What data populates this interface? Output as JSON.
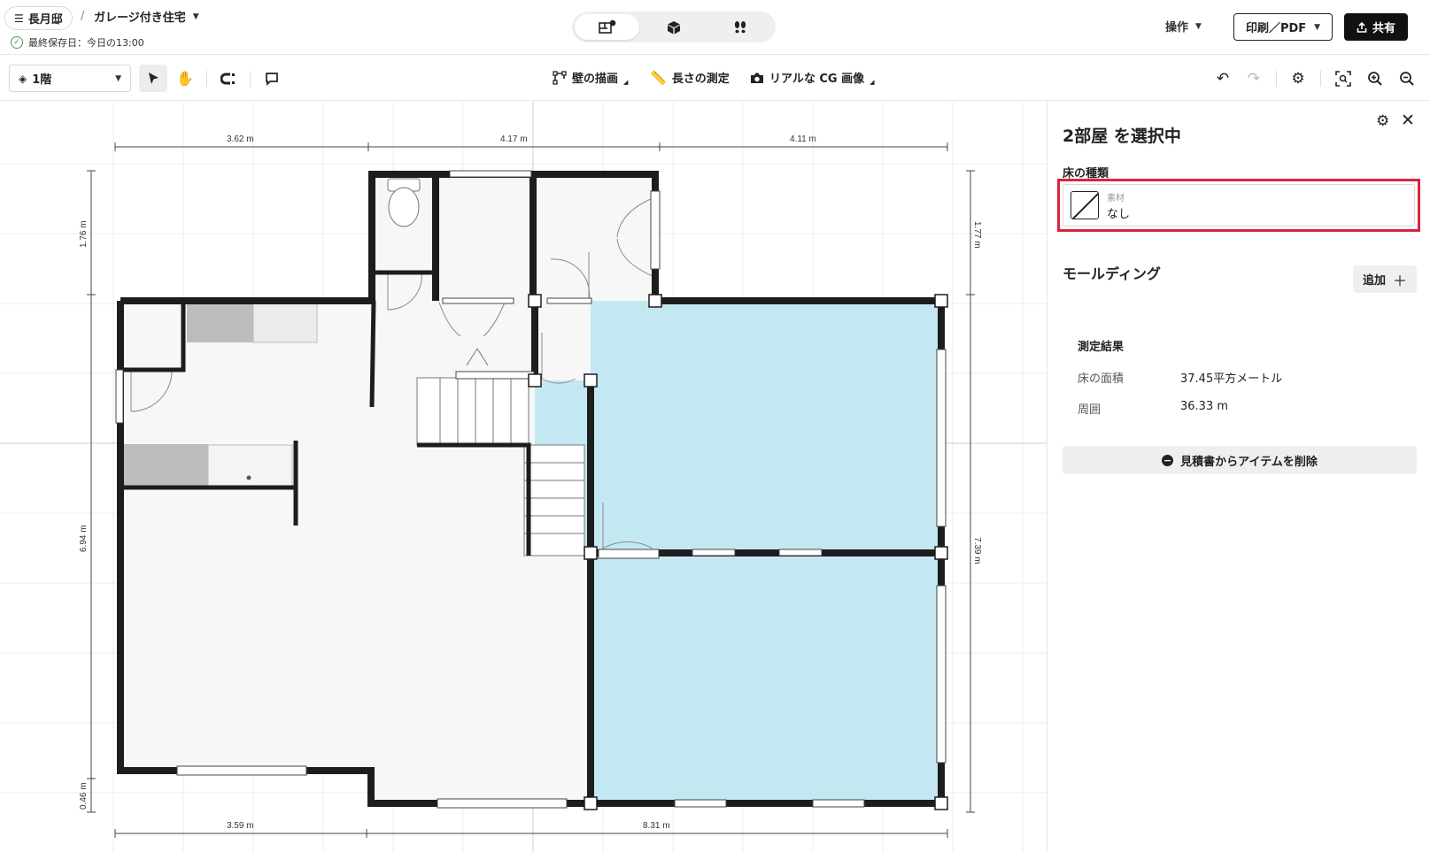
{
  "header": {
    "menu_label": "長月邸",
    "breadcrumb_sep": "/",
    "project_title": "ガレージ付き住宅",
    "save_status": "最終保存日：今日の13:00",
    "ops_label": "操作",
    "print_label": "印刷／PDF",
    "share_label": "共有"
  },
  "toolbar": {
    "floor_label": "1階",
    "draw_walls": "壁の描画",
    "measure": "長さの測定",
    "render": "リアルな CG 画像"
  },
  "canvas": {
    "dims_top": [
      "3.62 m",
      "4.17 m",
      "4.11 m"
    ],
    "dims_bottom": [
      "3.59 m",
      "8.31 m"
    ],
    "dims_left": [
      "1.76 m",
      "6.94 m",
      "0.46 m"
    ],
    "dims_right": [
      "1.77 m",
      "7.39 m"
    ],
    "selection_color": "#c4e8f2"
  },
  "panel": {
    "title": "2部屋 を選択中",
    "floor_type_label": "床の種類",
    "material_caption": "素材",
    "material_value": "なし",
    "molding_label": "モールディング",
    "add_label": "追加",
    "results_title": "測定結果",
    "results": [
      {
        "key": "床の面積",
        "value": "37.45平方メートル"
      },
      {
        "key": "周囲",
        "value": "36.33 m"
      }
    ],
    "delete_label": "見積書からアイテムを削除"
  }
}
